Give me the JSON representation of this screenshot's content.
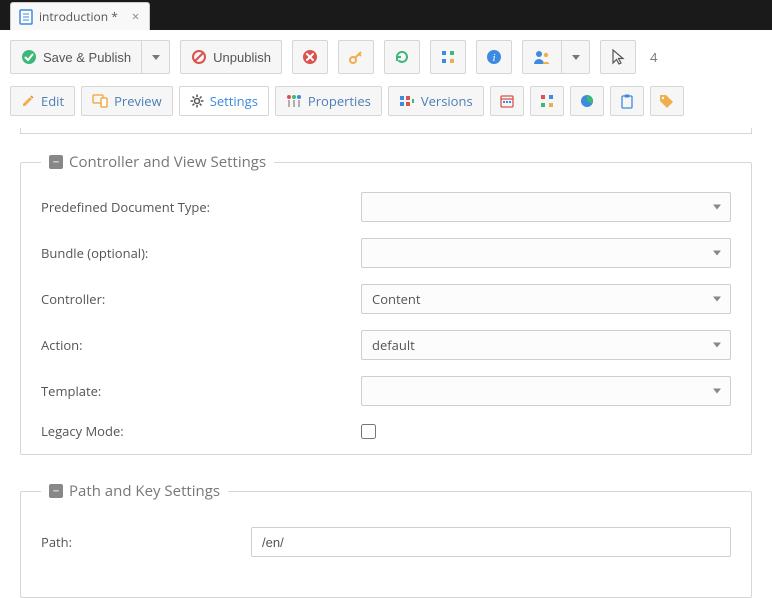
{
  "tab": {
    "title": "introduction *"
  },
  "toolbar": {
    "save_publish": "Save & Publish",
    "unpublish": "Unpublish",
    "page_count": "4"
  },
  "navtabs": {
    "edit": "Edit",
    "preview": "Preview",
    "settings": "Settings",
    "properties": "Properties",
    "versions": "Versions"
  },
  "sections": {
    "controller": {
      "legend": "Controller and View Settings",
      "fields": {
        "predefined": "Predefined Document Type:",
        "bundle": "Bundle (optional):",
        "controller": "Controller:",
        "action": "Action:",
        "template": "Template:",
        "legacy": "Legacy Mode:"
      },
      "values": {
        "predefined": "",
        "bundle": "",
        "controller": "Content",
        "action": "default",
        "template": ""
      }
    },
    "pathkey": {
      "legend": "Path and Key Settings",
      "fields": {
        "path": "Path:"
      },
      "values": {
        "path": "/en/"
      }
    }
  }
}
